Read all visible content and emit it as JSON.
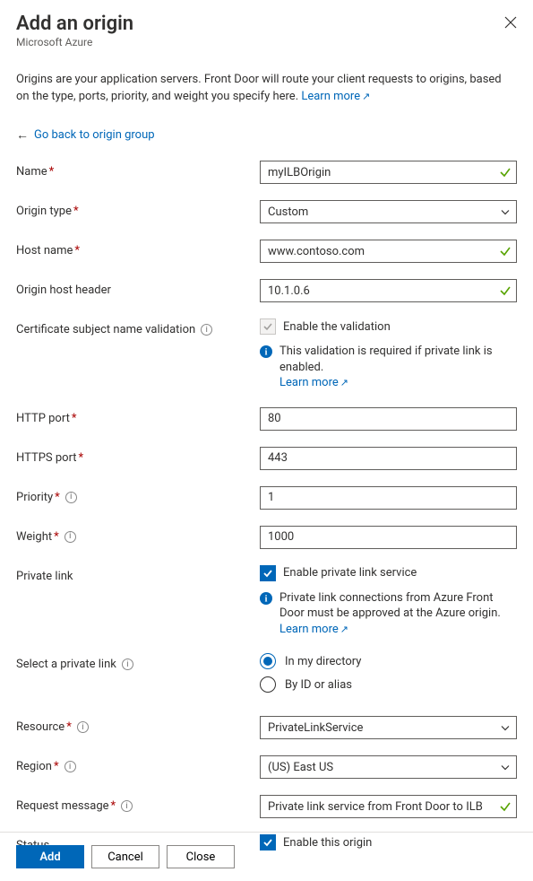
{
  "header": {
    "title": "Add an origin",
    "subtitle": "Microsoft Azure"
  },
  "intro": {
    "text": "Origins are your application servers. Front Door will route your client requests to origins, based on the type, ports, priority, and weight you specify here. ",
    "learn_more": "Learn more"
  },
  "back_link": "Go back to origin group",
  "labels": {
    "name": "Name",
    "origin_type": "Origin type",
    "host_name": "Host name",
    "origin_host_header": "Origin host header",
    "cert_validation": "Certificate subject name validation",
    "http_port": "HTTP port",
    "https_port": "HTTPS port",
    "priority": "Priority",
    "weight": "Weight",
    "private_link": "Private link",
    "select_private_link": "Select a private link",
    "resource": "Resource",
    "region": "Region",
    "request_message": "Request message",
    "status": "Status"
  },
  "values": {
    "name": "myILBOrigin",
    "origin_type": "Custom",
    "host_name": "www.contoso.com",
    "origin_host_header": "10.1.0.6",
    "http_port": "80",
    "https_port": "443",
    "priority": "1",
    "weight": "1000",
    "resource": "PrivateLinkService",
    "region": "(US) East US",
    "request_message": "Private link service from Front Door to ILB"
  },
  "checkboxes": {
    "enable_validation": "Enable the validation",
    "enable_private_link": "Enable private link service",
    "enable_origin": "Enable this origin"
  },
  "info": {
    "validation_required": "This validation is required if private link is enabled.",
    "private_link_note": "Private link connections from Azure Front Door must be approved at the Azure origin.",
    "learn_more": "Learn more"
  },
  "radio": {
    "in_directory": "In my directory",
    "by_id": "By ID or alias"
  },
  "buttons": {
    "add": "Add",
    "cancel": "Cancel",
    "close": "Close"
  }
}
